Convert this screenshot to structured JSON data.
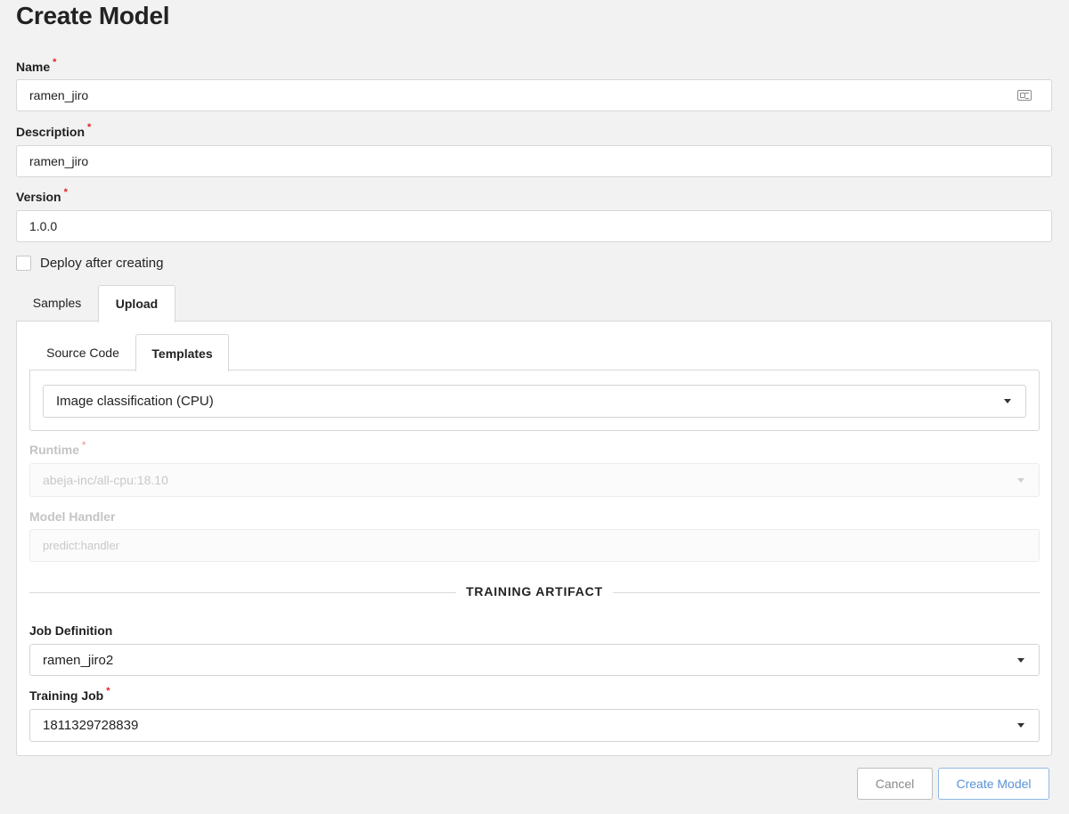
{
  "page": {
    "title": "Create Model"
  },
  "form": {
    "name": {
      "label": "Name",
      "required_mark": "*",
      "value": "ramen_jiro"
    },
    "description": {
      "label": "Description",
      "required_mark": "*",
      "value": "ramen_jiro"
    },
    "version": {
      "label": "Version",
      "required_mark": "*",
      "value": "1.0.0"
    },
    "deploy": {
      "label": "Deploy after creating",
      "checked": false
    }
  },
  "tabs": {
    "samples": "Samples",
    "upload": "Upload",
    "active": "Upload"
  },
  "subtabs": {
    "source_code": "Source Code",
    "templates": "Templates",
    "active": "Templates"
  },
  "template_select": {
    "value": "Image classification (CPU)"
  },
  "runtime": {
    "label": "Runtime",
    "required_mark": "*",
    "value": "abeja-inc/all-cpu:18.10",
    "disabled": true
  },
  "model_handler": {
    "label": "Model Handler",
    "value": "predict:handler",
    "disabled": true
  },
  "training_artifact": {
    "heading": "TRAINING ARTIFACT",
    "job_definition": {
      "label": "Job Definition",
      "value": "ramen_jiro2"
    },
    "training_job": {
      "label": "Training Job",
      "required_mark": "*",
      "value": "1811329728839"
    }
  },
  "actions": {
    "cancel": "Cancel",
    "create": "Create Model"
  },
  "colors": {
    "required": "#e02020",
    "primary": "#5a93d6",
    "background": "#f2f2f2"
  }
}
